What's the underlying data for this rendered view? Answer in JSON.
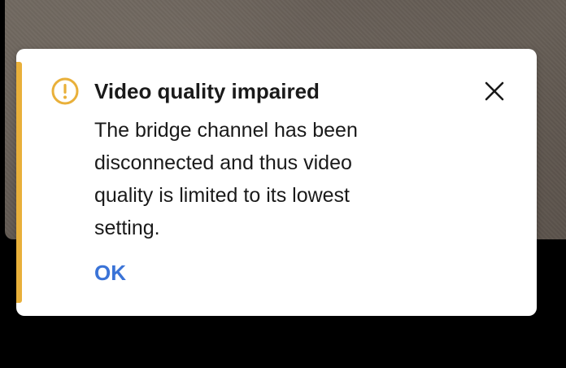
{
  "notification": {
    "title": "Video quality impaired",
    "message_lines": [
      "The bridge channel has been",
      "disconnected and thus video",
      "quality is limited to its lowest",
      "setting."
    ],
    "ok_label": "OK",
    "icons": {
      "status": "warning-circle-icon",
      "close": "close-icon"
    },
    "colors": {
      "accent": "#e9b03a",
      "link": "#3a73d7",
      "text": "#1a1a1a"
    }
  }
}
